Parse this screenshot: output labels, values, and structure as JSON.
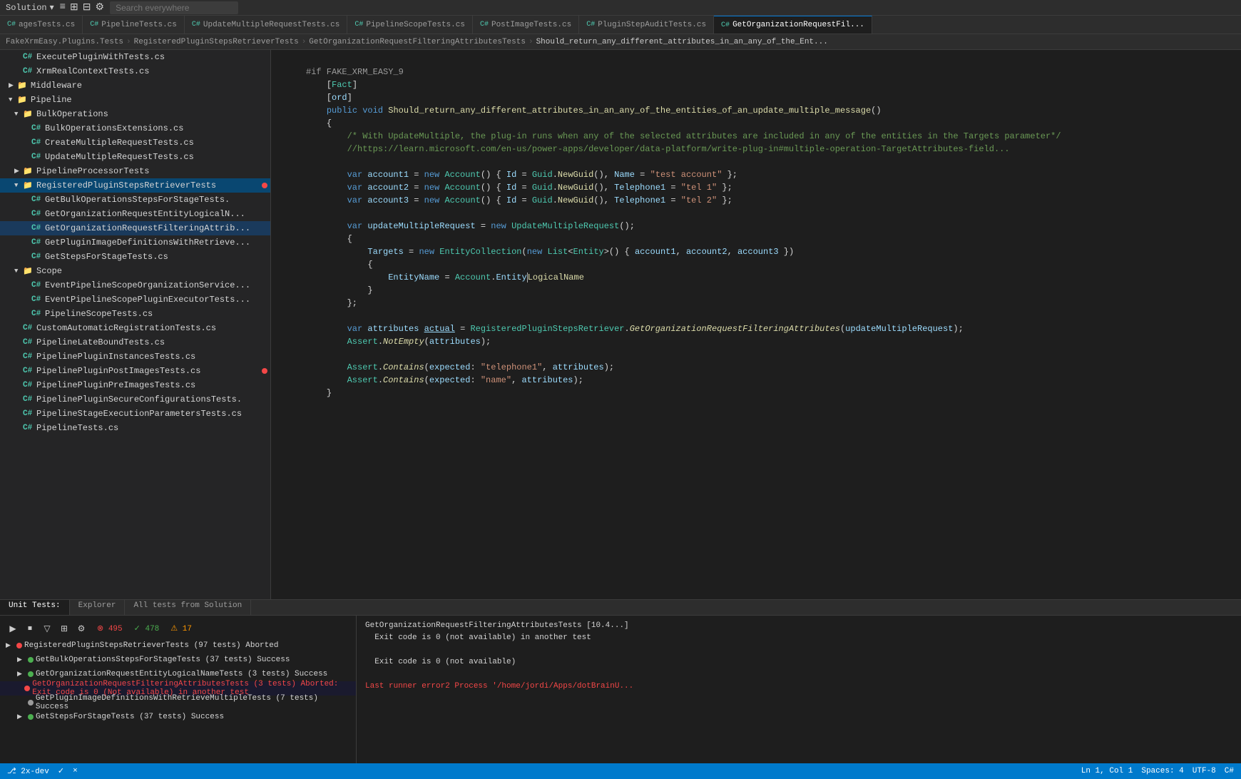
{
  "topbar": {
    "solution_label": "Solution",
    "search_placeholder": "Search everywhere",
    "icons": [
      "≡",
      "⊞",
      "⊟",
      "⚙"
    ]
  },
  "tabs": [
    {
      "id": "agesTests",
      "label": "agesTests.cs",
      "prefix": "C#",
      "active": false
    },
    {
      "id": "pipelineTests",
      "label": "PipelineTests.cs",
      "prefix": "C#",
      "active": false
    },
    {
      "id": "updateMultiple",
      "label": "UpdateMultipleRequestTests.cs",
      "prefix": "C#",
      "active": false
    },
    {
      "id": "pipelineScope",
      "label": "PipelineScopeTests.cs",
      "prefix": "C#",
      "active": false
    },
    {
      "id": "postImage",
      "label": "PostImageTests.cs",
      "prefix": "C#",
      "active": false
    },
    {
      "id": "pluginStepAudit",
      "label": "PluginStepAuditTests.cs",
      "prefix": "C#",
      "active": false
    },
    {
      "id": "getOrg",
      "label": "GetOrganizationRequestFil...",
      "prefix": "C#",
      "active": true
    }
  ],
  "breadcrumb": {
    "items": [
      "FakeXrmEasy.Plugins.Tests",
      "RegisteredPluginStepsRetrieverTests",
      "GetOrganizationRequestFilteringAttributesTests",
      "Should_return_any_different_attributes_in_an_any_of_the_Ent..."
    ]
  },
  "sidebar": {
    "items": [
      {
        "indent": 4,
        "type": "file",
        "label": "ExecutePluginWithTests.cs",
        "arrow": "",
        "dot": false
      },
      {
        "indent": 4,
        "type": "file",
        "label": "XrmRealContextTests.cs",
        "arrow": "",
        "dot": false
      },
      {
        "indent": 2,
        "type": "folder",
        "label": "Middleware",
        "arrow": "▶",
        "dot": false
      },
      {
        "indent": 2,
        "type": "folder",
        "label": "Pipeline",
        "arrow": "▼",
        "dot": false
      },
      {
        "indent": 4,
        "type": "folder",
        "label": "BulkOperations",
        "arrow": "▼",
        "dot": false
      },
      {
        "indent": 6,
        "type": "file",
        "label": "BulkOperationsExtensions.cs",
        "arrow": "",
        "dot": false
      },
      {
        "indent": 6,
        "type": "file",
        "label": "CreateMultipleRequestTests.cs",
        "arrow": "",
        "dot": false
      },
      {
        "indent": 6,
        "type": "file",
        "label": "UpdateMultipleRequestTests.cs",
        "arrow": "",
        "dot": false
      },
      {
        "indent": 4,
        "type": "folder",
        "label": "PipelineProcessorTests",
        "arrow": "▶",
        "dot": false
      },
      {
        "indent": 4,
        "type": "folder",
        "label": "RegisteredPluginStepsRetrieverTests",
        "arrow": "▼",
        "dot": true
      },
      {
        "indent": 6,
        "type": "file",
        "label": "GetBulkOperationsStepsForStageTests.",
        "arrow": "",
        "dot": false
      },
      {
        "indent": 6,
        "type": "file",
        "label": "GetOrganizationRequestEntityLogicalN...",
        "arrow": "",
        "dot": false
      },
      {
        "indent": 6,
        "type": "file",
        "label": "GetOrganizationRequestFilteringAttrib...",
        "arrow": "",
        "dot": false,
        "selected": true
      },
      {
        "indent": 6,
        "type": "file",
        "label": "GetPluginImageDefinitionsWithRetrieve...",
        "arrow": "",
        "dot": false
      },
      {
        "indent": 6,
        "type": "file",
        "label": "GetStepsForStageTests.cs",
        "arrow": "",
        "dot": false
      },
      {
        "indent": 4,
        "type": "folder",
        "label": "Scope",
        "arrow": "▼",
        "dot": false
      },
      {
        "indent": 6,
        "type": "file",
        "label": "EventPipelineScopeOrganizationService...",
        "arrow": "",
        "dot": false
      },
      {
        "indent": 6,
        "type": "file",
        "label": "EventPipelineScopePluginExecutorTests...",
        "arrow": "",
        "dot": false
      },
      {
        "indent": 6,
        "type": "file",
        "label": "PipelineScopeTests.cs",
        "arrow": "",
        "dot": false
      },
      {
        "indent": 4,
        "type": "file",
        "label": "CustomAutomaticRegistrationTests.cs",
        "arrow": "",
        "dot": false
      },
      {
        "indent": 4,
        "type": "file",
        "label": "PipelineLateBoundTests.cs",
        "arrow": "",
        "dot": false
      },
      {
        "indent": 4,
        "type": "file",
        "label": "PipelinePluginInstancesTests.cs",
        "arrow": "",
        "dot": false
      },
      {
        "indent": 4,
        "type": "file",
        "label": "PipelinePluginPostImagesTests.cs",
        "arrow": "",
        "dot": true
      },
      {
        "indent": 4,
        "type": "file",
        "label": "PipelinePluginPreImagesTests.cs",
        "arrow": "",
        "dot": false
      },
      {
        "indent": 4,
        "type": "file",
        "label": "PipelinePluginSecureConfigurationsTests.",
        "arrow": "",
        "dot": false
      },
      {
        "indent": 4,
        "type": "file",
        "label": "PipelineStageExecutionParametersTests.cs",
        "arrow": "",
        "dot": false
      },
      {
        "indent": 4,
        "type": "file",
        "label": "PipelineTests.cs",
        "arrow": "",
        "dot": false
      }
    ]
  },
  "code": {
    "lines": [
      {
        "num": "",
        "content": ""
      },
      {
        "num": "",
        "content": "#if FAKE_XRM_EASY_9"
      },
      {
        "num": "",
        "content": "    [Fact]"
      },
      {
        "num": "",
        "content": "    [ord]"
      },
      {
        "num": "",
        "content": "    public void Should_return_any_different_attributes_in_an_any_of_the_entities_of_an_update_multiple_message()"
      },
      {
        "num": "",
        "content": "    {"
      },
      {
        "num": "",
        "content": "        /* With UpdateMultiple, the plug-in runs when any of the selected attributes are included in any of the entities in the Targets parameter*/"
      },
      {
        "num": "",
        "content": "        //https://learn.microsoft.com/en-us/power-apps/developer/data-platform/write-plug-in#multiple-operation-TargetAttributes-field..."
      },
      {
        "num": "",
        "content": ""
      },
      {
        "num": "",
        "content": "        var account1 = new Account() { Id = Guid.NewGuid(), Name = \"test account\" };"
      },
      {
        "num": "",
        "content": "        var account2 = new Account() { Id = Guid.NewGuid(), Telephone1 = \"tel 1\" };"
      },
      {
        "num": "",
        "content": "        var account3 = new Account() { Id = Guid.NewGuid(), Telephone1 = \"tel 2\" };"
      },
      {
        "num": "",
        "content": ""
      },
      {
        "num": "",
        "content": "        var updateMultipleRequest = new UpdateMultipleRequest();"
      },
      {
        "num": "",
        "content": "        {"
      },
      {
        "num": "",
        "content": "            Targets = new EntityCollection(new List<Entity>() { account1, account2, account3 })"
      },
      {
        "num": "",
        "content": "            {"
      },
      {
        "num": "",
        "content": "                EntityName = Account.EntityLogicalName"
      },
      {
        "num": "",
        "content": "            }"
      },
      {
        "num": "",
        "content": "        };"
      },
      {
        "num": "",
        "content": ""
      },
      {
        "num": "",
        "content": "        var attributes actual = RegisteredPluginStepsRetriever.GetOrganizationRequestFilteringAttributes(updateMultipleRequest);"
      },
      {
        "num": "",
        "content": "        Assert.NotEmpty(attributes);"
      },
      {
        "num": "",
        "content": ""
      },
      {
        "num": "",
        "content": "        Assert.Contains(expected: \"telephone1\", attributes);"
      },
      {
        "num": "",
        "content": "        Assert.Contains(expected: \"name\", attributes);"
      },
      {
        "num": "",
        "content": "    }"
      }
    ]
  },
  "bottom": {
    "tabs": [
      "Unit Tests:",
      "Explorer",
      "All tests from Solution"
    ],
    "stats": {
      "total": "495",
      "passed": "478",
      "failed": "17"
    },
    "test_items": [
      {
        "indent": 4,
        "status": "aborted",
        "label": "RegisteredPluginStepsRetrieverTests (97 tests) Aborted",
        "has_arrow": true
      },
      {
        "indent": 8,
        "status": "success",
        "label": "GetBulkOperationsStepsForStageTests (37 tests) Success",
        "has_arrow": true
      },
      {
        "indent": 8,
        "status": "success",
        "label": "GetOrganizationRequestEntityLogicalNameTests (3 tests) Success",
        "has_arrow": true
      },
      {
        "indent": 8,
        "status": "aborted",
        "label": "GetOrganizationRequestFilteringAttributesTests (3 tests) Aborted: Exit code is 0 (Not available) in another test",
        "has_arrow": false
      },
      {
        "indent": 8,
        "status": "skip",
        "label": "GetPluginImageDefinitionsWithRetrieveMultipleTests (7 tests) Success",
        "has_arrow": false
      },
      {
        "indent": 8,
        "status": "success",
        "label": "GetStepsForStageTests (37 tests) Success",
        "has_arrow": false
      }
    ],
    "output": [
      {
        "text": "GetOrganizationRequestFilteringAttributesTests [10.4...]",
        "style": "normal"
      },
      {
        "text": "  Exit code is 0 (not available) in another test",
        "style": "normal"
      },
      {
        "text": "",
        "style": "normal"
      },
      {
        "text": "  Exit code is 0 (not available)",
        "style": "normal"
      },
      {
        "text": "",
        "style": "normal"
      },
      {
        "text": "Last runner error2 Process '/home/jordi/Apps/dotBrainU...",
        "style": "red"
      }
    ]
  },
  "statusbar": {
    "left": [
      "2x-dev",
      "⎇",
      "✓",
      "×"
    ],
    "right": [
      "Ln 1, Col 1",
      "Spaces: 4",
      "UTF-8",
      "C#"
    ]
  }
}
